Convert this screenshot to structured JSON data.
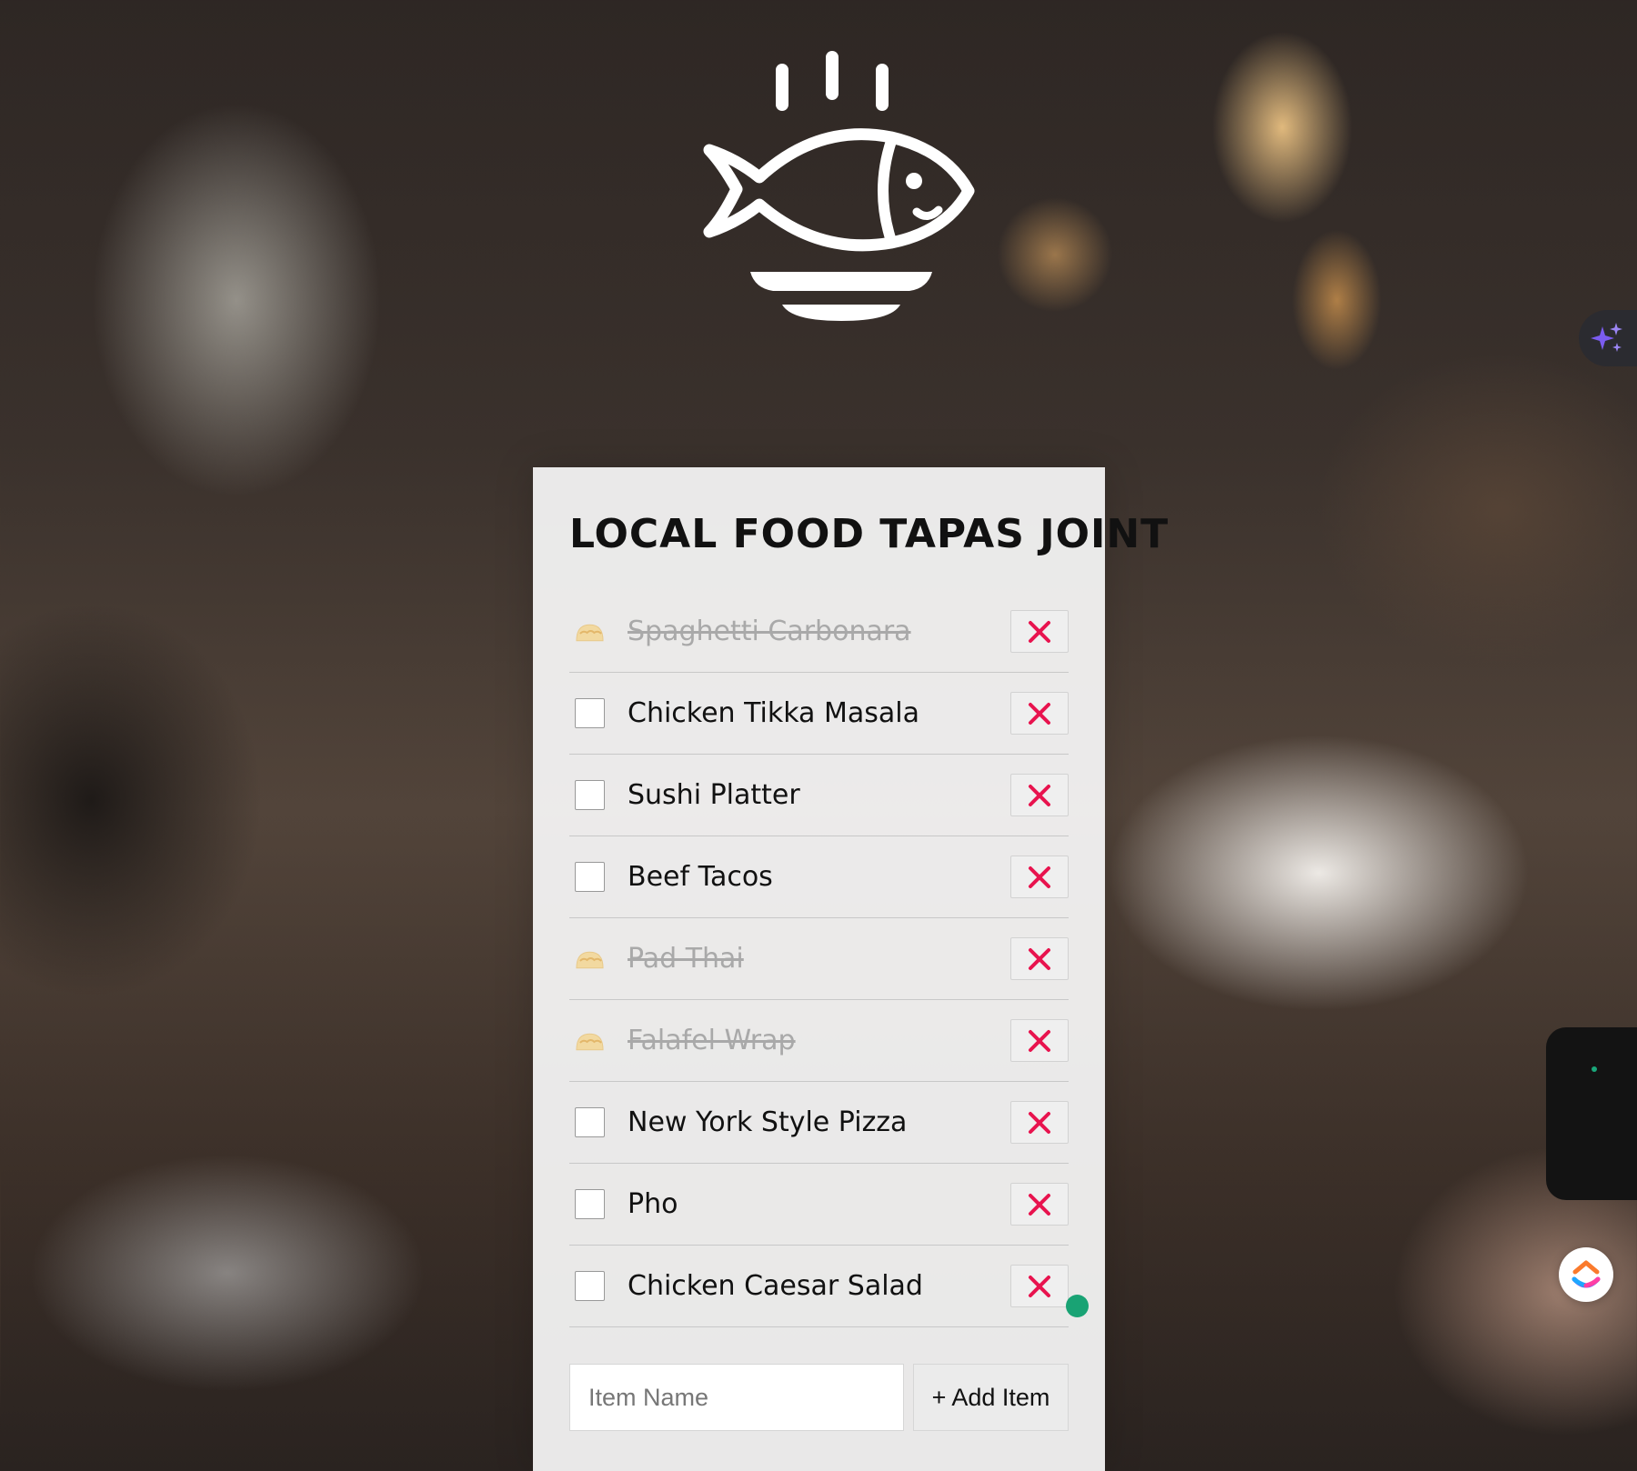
{
  "app": {
    "title": "LOCAL FOOD TAPAS JOINT",
    "logo_icon": "fish-on-plate-steaming-icon"
  },
  "items": [
    {
      "label": "Spaghetti Carbonara",
      "done": true
    },
    {
      "label": "Chicken Tikka Masala",
      "done": false
    },
    {
      "label": "Sushi Platter",
      "done": false
    },
    {
      "label": "Beef Tacos",
      "done": false
    },
    {
      "label": "Pad Thai",
      "done": true
    },
    {
      "label": "Falafel Wrap",
      "done": true
    },
    {
      "label": "New York Style Pizza",
      "done": false
    },
    {
      "label": "Pho",
      "done": false
    },
    {
      "label": "Chicken Caesar Salad",
      "done": false
    }
  ],
  "add_form": {
    "placeholder": "Item Name",
    "value": "",
    "button_label": "+ Add Item"
  },
  "icons": {
    "done": "taco-icon",
    "delete": "close-x-icon",
    "ai": "sparkles-icon",
    "clickup": "clickup-logo-icon"
  },
  "colors": {
    "delete_x": "#e8134e",
    "done_text": "#a9a9a9",
    "status_dot": "#19a374"
  }
}
